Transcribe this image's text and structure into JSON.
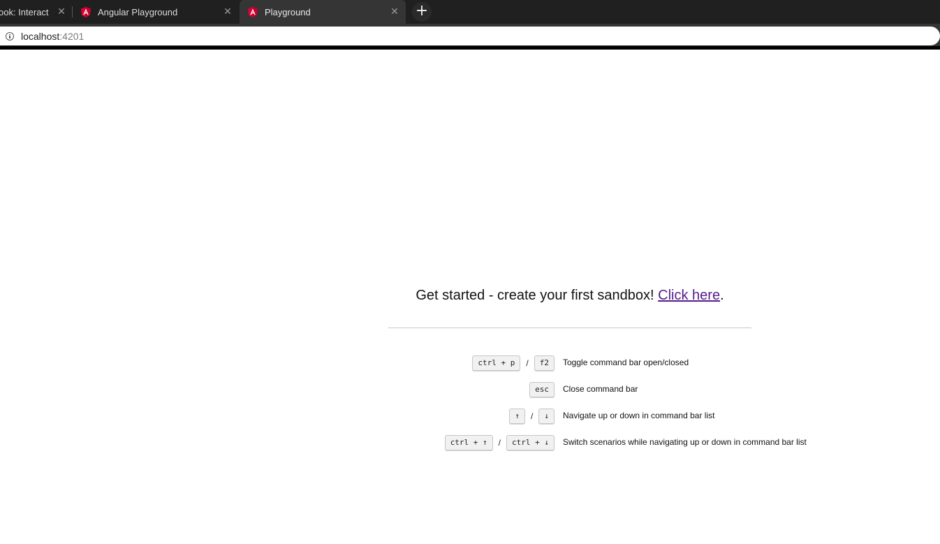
{
  "browser": {
    "tabs": [
      {
        "title": "ook: Interact",
        "favicon": "none",
        "active": false
      },
      {
        "title": "Angular Playground",
        "favicon": "angular-icon",
        "active": false
      },
      {
        "title": "Playground",
        "favicon": "angular-icon",
        "active": true
      }
    ],
    "new_tab_label": "+",
    "close_glyph": "✕",
    "address": {
      "host": "localhost",
      "port": ":4201"
    }
  },
  "page": {
    "headline_text": "Get started - create your first sandbox! ",
    "headline_link": "Click here",
    "headline_end": ".",
    "shortcuts": [
      {
        "keys": [
          "ctrl + p",
          "f2"
        ],
        "description": "Toggle command bar open/closed"
      },
      {
        "keys": [
          "esc"
        ],
        "description": "Close command bar"
      },
      {
        "keys": [
          "↑",
          "↓"
        ],
        "description": "Navigate up or down in command bar list"
      },
      {
        "keys": [
          "ctrl + ↑",
          "ctrl + ↓"
        ],
        "description": "Switch scenarios while navigating up or down in command bar list"
      }
    ],
    "key_separator": "/"
  },
  "colors": {
    "tabbar_bg": "#202020",
    "active_tab_bg": "#353535",
    "link_visited": "#551a8b",
    "angular_red": "#dd0031"
  }
}
